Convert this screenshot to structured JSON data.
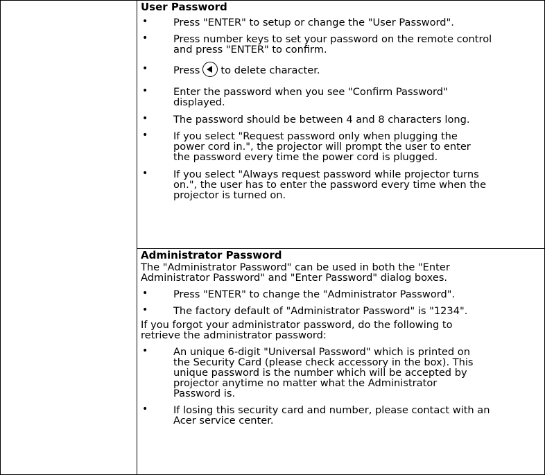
{
  "user_section": {
    "heading": "User Password",
    "bullets": [
      [
        "Press \"ENTER\" to setup or change the \"User Password\"."
      ],
      [
        "Press number keys to set your password on the remote control",
        "and press \"ENTER\" to confirm."
      ],
      [
        "Press",
        "to delete character."
      ],
      [
        "Enter the password when you see \"Confirm Password\"",
        "displayed."
      ],
      [
        "The password should be between 4 and 8 characters long."
      ],
      [
        "If you select \"Request password only when plugging the",
        "power cord in.\", the projector will prompt the user to enter",
        "the password every time the power cord is plugged."
      ],
      [
        "If you select \"Always request password while projector turns",
        "on.\", the user has to enter the password every time when the",
        "projector is turned on."
      ]
    ]
  },
  "admin_section": {
    "heading": "Administrator Password",
    "intro": [
      "The \"Administrator Password\" can be used in both the \"Enter",
      "Administrator Password\" and \"Enter Password\" dialog boxes."
    ],
    "bullets_a": [
      [
        "Press \"ENTER\" to change the \"Administrator Password\"."
      ],
      [
        "The factory default of \"Administrator Password\" is \"1234\"."
      ]
    ],
    "forgot": [
      "If you forgot your administrator password, do the following to",
      "retrieve the administrator password:"
    ],
    "bullets_b": [
      [
        "An unique 6-digit \"Universal Password\" which is printed on",
        "the Security Card (please check accessory in the box). This",
        "unique password is the number which will be accepted by",
        "projector anytime no matter what the Administrator",
        "Password is."
      ],
      [
        "If losing this security card and number, please contact with an",
        "Acer service center."
      ]
    ]
  },
  "icons": {
    "left_arrow_key": "left-arrow-key-icon"
  }
}
